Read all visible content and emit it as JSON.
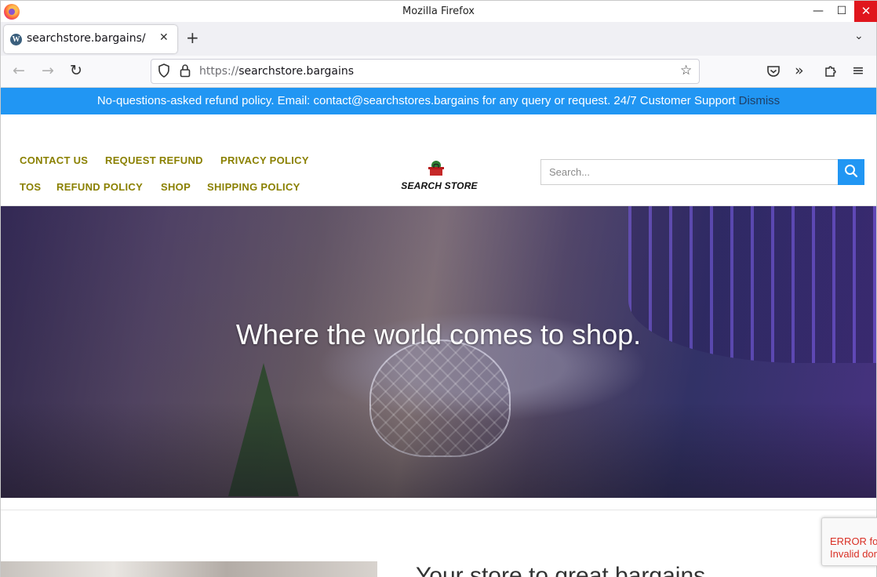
{
  "window": {
    "title": "Mozilla Firefox",
    "min_icon": "minimize-icon",
    "max_icon": "maximize-icon",
    "close_icon": "close-icon"
  },
  "tab": {
    "title": "searchstore.bargains/",
    "favicon": "wordpress-icon",
    "favicon_glyph": "W",
    "close_glyph": "✕",
    "new_tab_glyph": "+",
    "list_glyph": "⌄"
  },
  "navbar": {
    "back_glyph": "←",
    "forward_glyph": "→",
    "reload_glyph": "↻",
    "url_scheme": "https://",
    "url_host": "searchstore.bargains",
    "star_glyph": "☆",
    "more_glyph": "»",
    "menu_glyph": "≡"
  },
  "banner": {
    "text": "No-questions-asked refund policy. Email: contact@searchstores.bargains for any query or request. 24/7 Customer Support ",
    "dismiss": "Dismiss",
    "color": "#2196f3"
  },
  "site_menu": {
    "row1": [
      "CONTACT US",
      "REQUEST REFUND",
      "PRIVACY POLICY"
    ],
    "row2": [
      "TOS",
      "REFUND POLICY",
      "SHOP",
      "SHIPPING POLICY"
    ],
    "color": "#8a8000"
  },
  "logo": {
    "text": "SEARCH STORE"
  },
  "search": {
    "placeholder": "Search...",
    "value": ""
  },
  "hero": {
    "title": "Where the world comes to shop."
  },
  "section": {
    "heading": "Your store to great bargains"
  },
  "recaptcha": {
    "line1": "ERROR for site owner:",
    "line2": "Invalid domain for site key"
  }
}
